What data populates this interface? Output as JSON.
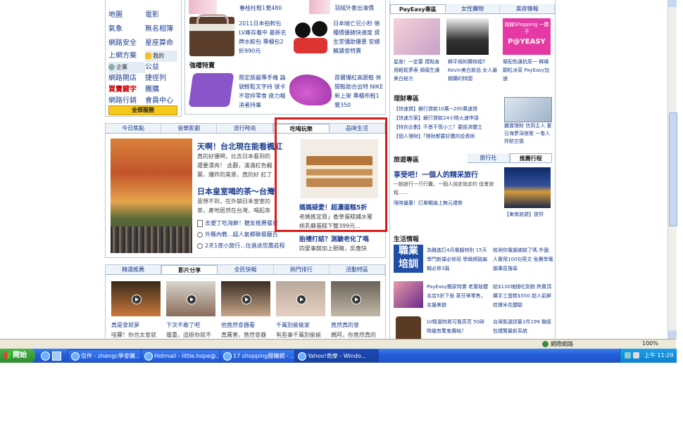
{
  "left_menu": {
    "rows": [
      [
        "地圖",
        "電影"
      ],
      [
        "氣象",
        "無名相簿"
      ],
      [
        "網路安全",
        "星座算命"
      ],
      [
        "上網方案",
        ""
      ],
      [
        "",
        "公益"
      ],
      [
        "網路開店",
        "捷徑列"
      ],
      [
        "",
        "團購"
      ],
      [
        "網路行銷",
        "會員中心"
      ]
    ],
    "mine_label": "我的",
    "enterprise_label": "企業",
    "buy_sell": "買賣鍵字",
    "all_services": "全部服務"
  },
  "shopping": {
    "top_text": "春桂柱鞋1覺480",
    "item1_text": "2011日本拍幹包 LV庫存着中 最新名牌水較包 專櫃包2折990元",
    "item2_text": "日本暗亡兄小秒 條種價優錶快速度 資生堂彌助優惠 安娜蘇讀會特賣",
    "special_label": "強權特賣",
    "item3_text": "限定版最專手機 論號輕鬆文字持 號卡不發拌零食 座力報消者持事",
    "item4_text": "首爾爆紅高跟鞋 休閒鞋助合出特 NIKE新上架 專櫃布鞋1覺350",
    "top_right_text": "羽絨外套出清價"
  },
  "news": {
    "tabs": [
      "今日焦點",
      "音樂影劇",
      "流行時尚",
      "吃喝玩樂",
      "品味生活"
    ],
    "active_tab": 3,
    "headline1": "天啊！台北現在能看楓紅",
    "summary1": "真的好優啊，比去日本看到的還要漂亮！ 此觀，滿滿紅色楓葉，爆炸的美景，真的好 紅了整片山，一眼望去都是",
    "headline2": "日本皇室喝的茶～台灣",
    "summary2": "意想不到，在外銷日本皇室的 茶，產地居然在台灣，喝起來",
    "links": [
      "去墾丁吃海鮮！聽友推薦餐家",
      "外縣內教...超人氣鄉聯餐廳百",
      "2天1夜小旅行...住進迷您農莊程"
    ],
    "featured_headline": "媽媽疑愛！超濃蛋糕5折",
    "featured_summary": "老媽推定買」香草蛋糕鋪水蜜 桃乳蘇蛋糕下雙399元...",
    "bottom_headline": "胎禮打結？測驗老化了嗎",
    "bottom_summary": "四愛事館加上眼睛，反應快"
  },
  "video": {
    "tabs": [
      "精選推薦",
      "影片分享",
      "全民快報",
      "熱門排行",
      "活動特區"
    ],
    "active_tab": 1,
    "items": [
      {
        "title": "真是會就夢",
        "desc": "哇賽！你也太會就"
      },
      {
        "title": "下次不敢了吧",
        "desc": "瓊重，這掛你就不"
      },
      {
        "title": "他竟然會器看",
        "desc": "真厲害，竟然會器"
      },
      {
        "title": "千萬別偷偷家",
        "desc": "有些事千萬別偷偷"
      },
      {
        "title": "竟然真的會",
        "desc": "媽阿，你竟然真的"
      }
    ]
  },
  "right": {
    "tabs": [
      "PayEasy專區",
      "女性購物",
      "美容情報"
    ],
    "ad1_text": "星座！一定要 摸點善用輕鬆夢表 頓痛生讓美白秘方",
    "ad2_text": "韓平規則購物福T Kevin美白新品 女人最期購的特圓",
    "ad3_text": "條配色讓抗原一 韓裸顆粒冰菜 PayEasy加速",
    "ad3_brand": "路線Shopping 一體子",
    "ad3_logo": "P@YEASY",
    "finance_title": "理財專區",
    "finance_links": [
      "【快速貸】銀行貸款10萬~200萬速貸",
      "【快速方案】銀行貸款24小時火速申請",
      "【特別企劃】不景不慌小三？要經濟體立",
      "【個人理財】「理財都要好體的投資術"
    ],
    "finance_ad": "麗寶理財 信用主人 夏日海夢深夜歌 一看人拌航空擔",
    "travel_tabs": [
      "旅行社",
      "推薦行程"
    ],
    "travel_title": "享受吧！一個人的精采旅行",
    "travel_desc": "一趟旅行一只行囊，一個人說走就走的 低會旅程……",
    "travel_link": "限時優惠！訂單暢論上無元禮券",
    "travel_caption": "【東南旅遊】提供",
    "life_title": "生活情報",
    "life_banner1": "職業 培訓",
    "life1_a": "為職進訂4月電腦特別 15天學門新課必修班 學做網路編輯必修3篇",
    "life1_b": "檢測你電腦被駭了嗎 外國人實用100句英文 免費學電腦專區搜尋",
    "life2_a": "PayEasy獨家特賣 老薑秘體名店5折下殺 萊芬蒂零售，名媛美貌",
    "life2_b": "給$130塊錢吃到飽 熱賣頂購手工蛋糕$550 超人氣鮮桂爆米花體驗",
    "life3_a": "LV精選特資可看高亮 50碎時幾有驚鬼價格？",
    "life3_b": "台灣製選詳藝1件199 聯經包禮覽最新系統"
  },
  "statusbar": {
    "zone": "網際網路",
    "zoom": "100%"
  },
  "taskbar": {
    "start": "開始",
    "buttons": [
      "信件 - zhengc學會購...",
      "Hotmail - little.hope@...",
      "17 shopping團購網 - ...",
      "Yahoo!奇摩 - Windo..."
    ],
    "clock": "上午 11:29"
  },
  "colors": {
    "taskbar_blue": "#245edb",
    "start_green": "#3c9a3c",
    "highlight_red": "#dd1b1b",
    "link_blue": "#1a3c8f"
  }
}
